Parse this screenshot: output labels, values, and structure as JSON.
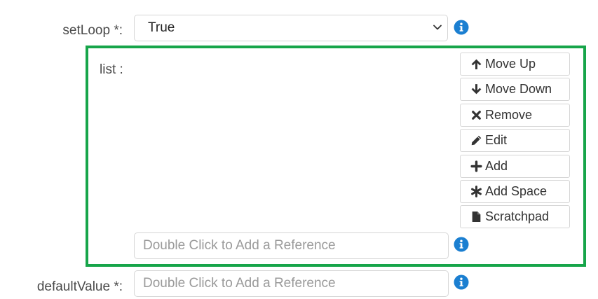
{
  "set_loop": {
    "label": "setLoop *:",
    "selected": "True"
  },
  "list": {
    "label": "list :",
    "buttons": [
      {
        "label": "Move Up",
        "icon": "arrow-up-icon"
      },
      {
        "label": "Move Down",
        "icon": "arrow-down-icon"
      },
      {
        "label": "Remove",
        "icon": "times-icon"
      },
      {
        "label": "Edit",
        "icon": "pencil-icon"
      },
      {
        "label": "Add",
        "icon": "plus-icon"
      },
      {
        "label": "Add Space",
        "icon": "asterisk-icon"
      },
      {
        "label": "Scratchpad",
        "icon": "file-icon"
      }
    ],
    "reference_placeholder": "Double Click to Add a Reference"
  },
  "default_value": {
    "label": "defaultValue *:",
    "placeholder": "Double Click to Add a Reference"
  },
  "colors": {
    "accent_border": "#17a54a",
    "info_icon": "#1b7fd1"
  }
}
